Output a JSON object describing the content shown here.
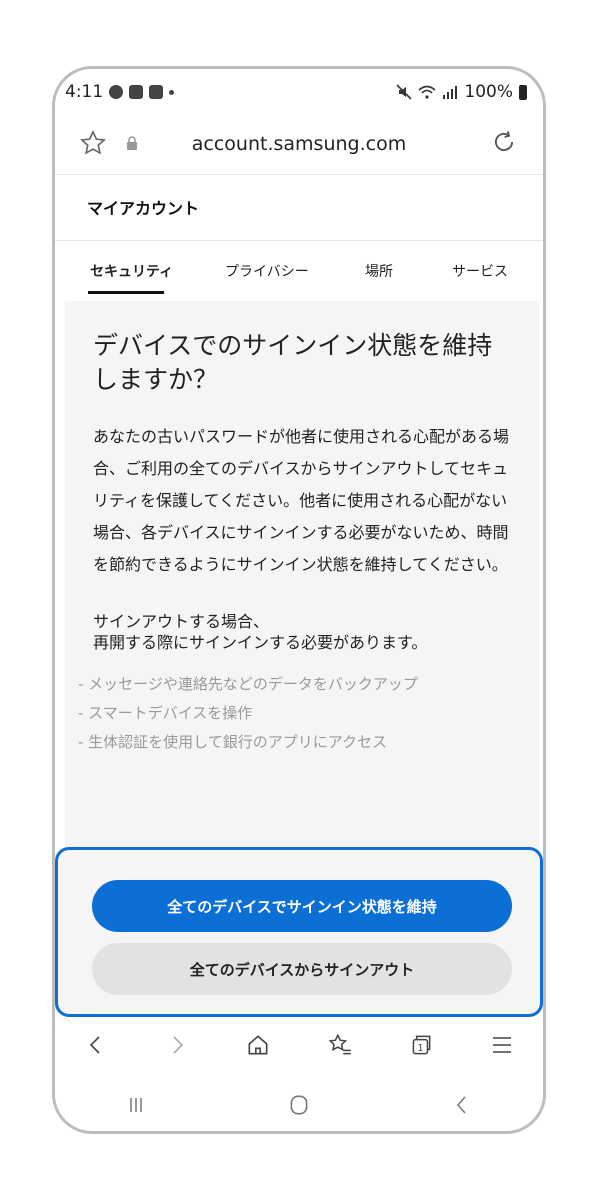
{
  "status_bar": {
    "time": "4:11",
    "battery_level": "100%"
  },
  "address_bar": {
    "url": "account.samsung.com"
  },
  "page": {
    "title": "マイアカウント",
    "tabs": [
      {
        "label": "セキュリティ",
        "active": true
      },
      {
        "label": "プライバシー",
        "active": false
      },
      {
        "label": "場所",
        "active": false
      },
      {
        "label": "サービス",
        "active": false
      }
    ]
  },
  "content": {
    "heading": "デバイスでのサインイン状態を維持しますか？",
    "description": "あなたの古いパスワードが他者に使用される心配がある場合、ご利用の全てのデバイスからサインアウトしてセキュリティを保護してください。他者に使用される心配がない場合、各デバイスにサインインする必要がないため、時間を節約できるようにサインイン状態を維持してください。",
    "signout_note_line1": "サインアウトする場合、",
    "signout_note_line2": "再開する際にサインインする必要があります。",
    "bullets": [
      "- メッセージや連絡先などのデータをバックアップ",
      "- スマートデバイスを操作",
      "- 生体認証を使用して銀行のアプリにアクセス"
    ]
  },
  "actions": {
    "keep_signed_in_label": "全てのデバイスでサインイン状態を維持",
    "sign_out_all_label": "全てのデバイスからサインアウト"
  },
  "colors": {
    "accent": "#0b6fd6",
    "secondary_button": "#e2e2e2",
    "content_background": "#f5f5f5",
    "muted_text": "#9a9a9a"
  },
  "icons": {
    "toolbar": [
      "back-icon",
      "forward-icon",
      "home-icon",
      "bookmarks-icon",
      "tabs-icon",
      "menu-icon"
    ],
    "address_bar": [
      "star-icon",
      "lock-icon",
      "reload-icon"
    ],
    "system_nav": [
      "recents-icon",
      "home-nav-icon",
      "back-nav-icon"
    ]
  }
}
